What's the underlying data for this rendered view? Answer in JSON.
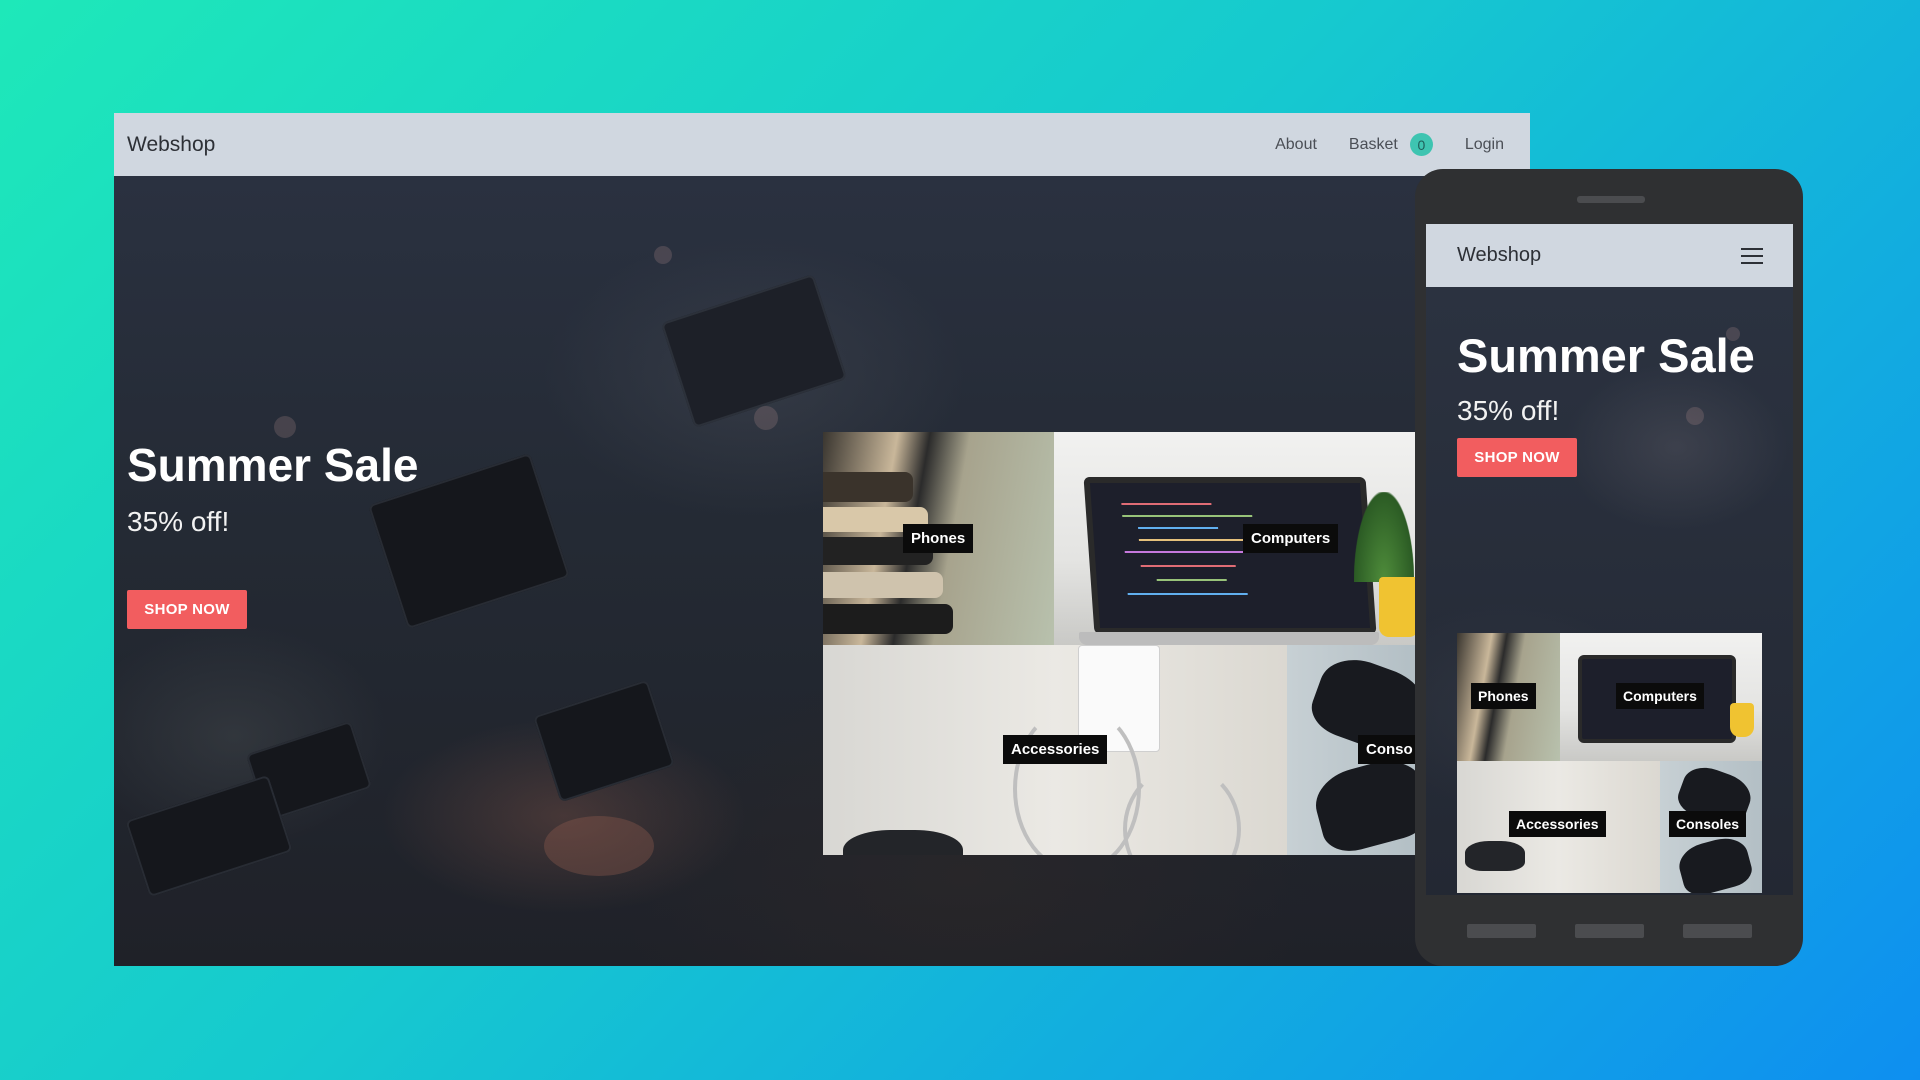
{
  "desktop": {
    "brand": "Webshop",
    "nav": {
      "about": "About",
      "basket": "Basket",
      "basket_count": "0",
      "login": "Login"
    },
    "hero": {
      "title": "Summer Sale",
      "subtitle": "35% off!",
      "cta": "SHOP NOW"
    },
    "categories": [
      "Phones",
      "Computers",
      "Accessories",
      "Conso"
    ]
  },
  "mobile": {
    "brand": "Webshop",
    "menu_icon": "hamburger-menu-icon",
    "hero": {
      "title": "Summer Sale",
      "subtitle": "35% off!",
      "cta": "SHOP NOW"
    },
    "categories": [
      "Phones",
      "Computers",
      "Accessories",
      "Consoles"
    ]
  },
  "colors": {
    "accent": "#f25d5f",
    "badge": "#3ec4b1",
    "navbar": "#d0d7e0"
  }
}
